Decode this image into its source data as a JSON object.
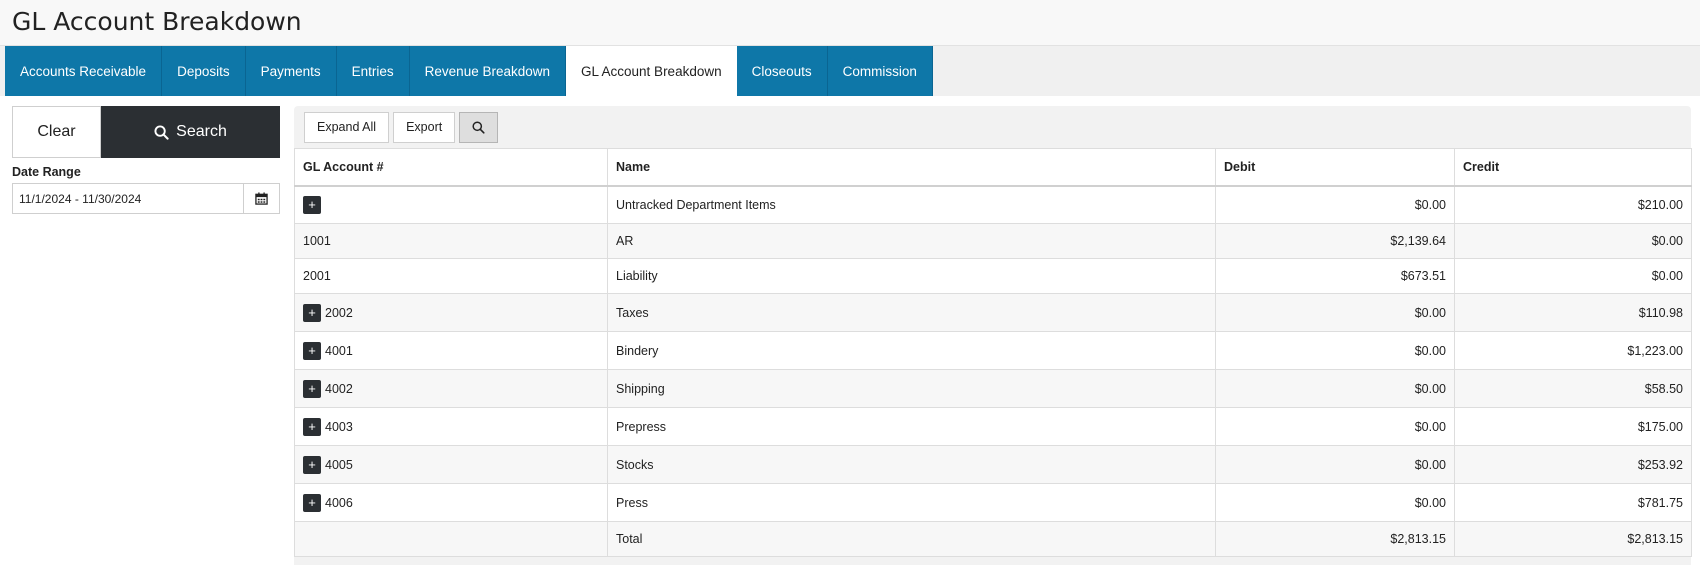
{
  "page": {
    "title": "GL Account Breakdown"
  },
  "tabs": [
    {
      "label": "Accounts Receivable",
      "active": false
    },
    {
      "label": "Deposits",
      "active": false
    },
    {
      "label": "Payments",
      "active": false
    },
    {
      "label": "Entries",
      "active": false
    },
    {
      "label": "Revenue Breakdown",
      "active": false
    },
    {
      "label": "GL Account Breakdown",
      "active": true
    },
    {
      "label": "Closeouts",
      "active": false
    },
    {
      "label": "Commission",
      "active": false
    }
  ],
  "filters": {
    "clear_label": "Clear",
    "search_label": "Search",
    "date_range_label": "Date Range",
    "date_range_value": "11/1/2024 - 11/30/2024"
  },
  "toolbar": {
    "expand_all_label": "Expand All",
    "export_label": "Export"
  },
  "table": {
    "columns": [
      "GL Account #",
      "Name",
      "Debit",
      "Credit"
    ],
    "expand_symbol": "+",
    "rows": [
      {
        "account": "",
        "name": "Untracked Department Items",
        "debit": "$0.00",
        "credit": "$210.00",
        "expandable": true
      },
      {
        "account": "1001",
        "name": "AR",
        "debit": "$2,139.64",
        "credit": "$0.00",
        "expandable": false
      },
      {
        "account": "2001",
        "name": "Liability",
        "debit": "$673.51",
        "credit": "$0.00",
        "expandable": false
      },
      {
        "account": "2002",
        "name": "Taxes",
        "debit": "$0.00",
        "credit": "$110.98",
        "expandable": true
      },
      {
        "account": "4001",
        "name": "Bindery",
        "debit": "$0.00",
        "credit": "$1,223.00",
        "expandable": true
      },
      {
        "account": "4002",
        "name": "Shipping",
        "debit": "$0.00",
        "credit": "$58.50",
        "expandable": true
      },
      {
        "account": "4003",
        "name": "Prepress",
        "debit": "$0.00",
        "credit": "$175.00",
        "expandable": true
      },
      {
        "account": "4005",
        "name": "Stocks",
        "debit": "$0.00",
        "credit": "$253.92",
        "expandable": true
      },
      {
        "account": "4006",
        "name": "Press",
        "debit": "$0.00",
        "credit": "$781.75",
        "expandable": true
      },
      {
        "account": "",
        "name": "Total",
        "debit": "$2,813.15",
        "credit": "$2,813.15",
        "expandable": false
      }
    ]
  },
  "colors": {
    "tab_bg": "#0e77a8",
    "search_button_bg": "#2b2f33"
  }
}
